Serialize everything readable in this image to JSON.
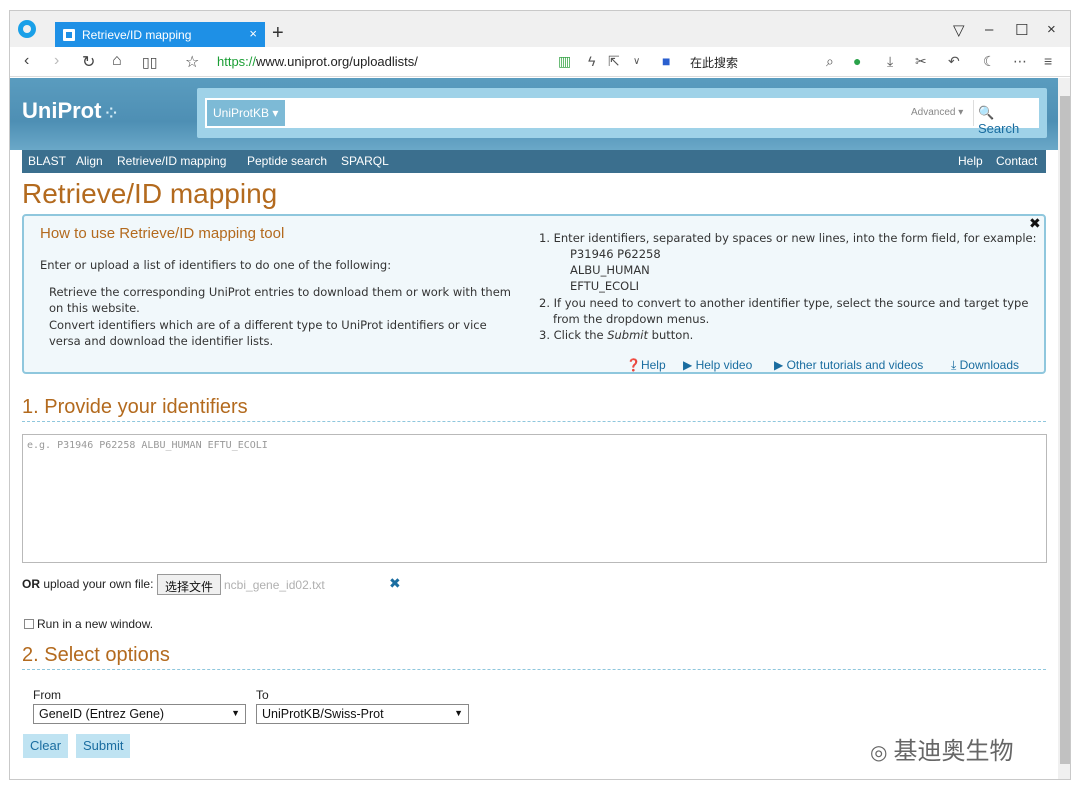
{
  "browser": {
    "tab_title": "Retrieve/ID mapping",
    "tab_close": "×",
    "new_tab": "+",
    "url_scheme": "https://",
    "url_rest": "www.uniprot.org/uploadlists/",
    "search_placeholder_cn": "在此搜索",
    "window_controls": [
      "▽",
      "–",
      "☐",
      "×"
    ]
  },
  "uniprot": {
    "logo": "UniProt",
    "db_select": "UniProtKB ▾",
    "advanced": "Advanced ▾",
    "search_button": "🔍 Search",
    "menu_left": [
      "BLAST",
      "Align",
      "Retrieve/ID mapping",
      "Peptide search",
      "SPARQL"
    ],
    "menu_right": [
      "Help",
      "Contact"
    ]
  },
  "page": {
    "title": "Retrieve/ID mapping",
    "info": {
      "title": "How to use Retrieve/ID mapping tool",
      "intro": "Enter or upload a list of identifiers to do one of the following:",
      "bullet1": "Retrieve the corresponding UniProt entries to download them or work with them on this website.",
      "bullet2": "Convert identifiers which are of a different type to UniProt identifiers or vice versa and download the identifier lists.",
      "step1": "1. Enter identifiers, separated by spaces or new lines, into the form field, for example:",
      "ex1": "P31946 P62258",
      "ex2": "ALBU_HUMAN",
      "ex3": "EFTU_ECOLI",
      "step2": "2. If you need to convert to another identifier type, select the source and target type",
      "step2b": "from the dropdown menus.",
      "step3_a": "3. Click the ",
      "step3_b": "Submit",
      "step3_c": " button.",
      "links": [
        "Help",
        "Help video",
        "Other tutorials and videos",
        "Downloads"
      ]
    },
    "section1": "1. Provide your identifiers",
    "id_placeholder": "e.g. P31946 P62258 ALBU_HUMAN EFTU_ECOLI",
    "upload_or": "OR",
    "upload_label": " upload your own file:",
    "file_button": "选择文件",
    "file_name": "ncbi_gene_id02.txt",
    "new_window": "Run in a new window.",
    "section2": "2. Select options",
    "from_label": "From",
    "from_value": "GeneID (Entrez Gene)",
    "to_label": "To",
    "to_value": "UniProtKB/Swiss-Prot",
    "clear_button": "Clear",
    "submit_button": "Submit"
  },
  "watermark": "基迪奥生物",
  "colors": {
    "accent": "#b36a1e",
    "link": "#1a6da0",
    "header": "#4e8fb4",
    "tab": "#1e90e6"
  }
}
